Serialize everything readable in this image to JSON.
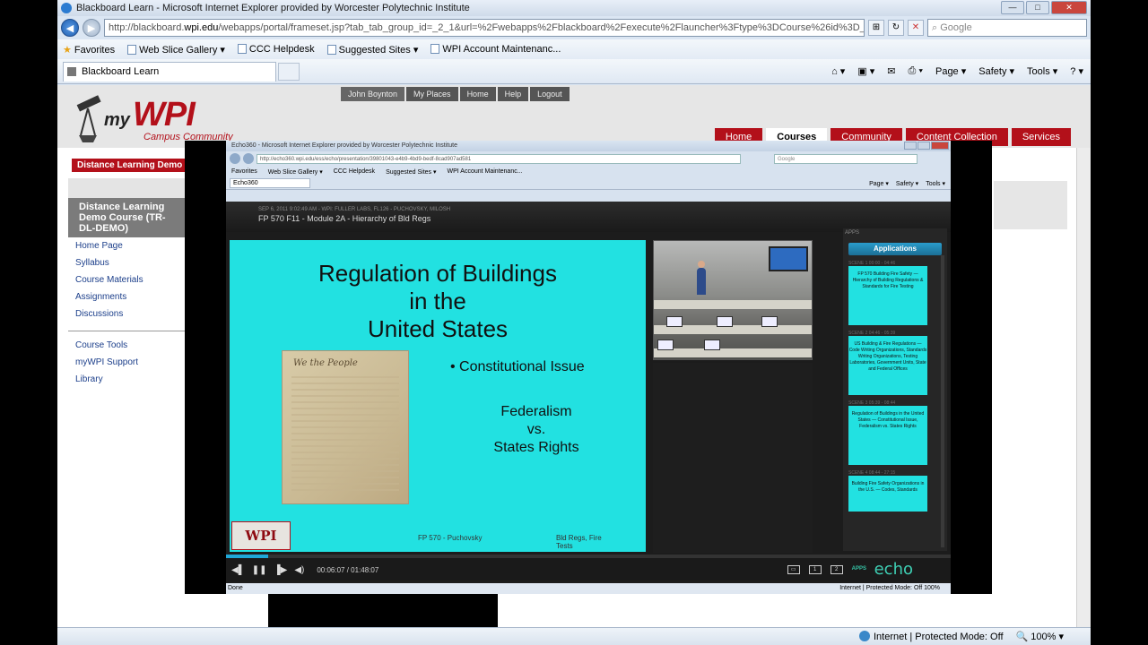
{
  "ie": {
    "title": "Blackboard Learn - Microsoft Internet Explorer provided by Worcester Polytechnic Institute",
    "url_prefix": "http://blackboard.",
    "url_domain": "wpi.edu",
    "url_rest": "/webapps/portal/frameset.jsp?tab_tab_group_id=_2_1&url=%2Fwebapps%2Fblackboard%2Fexecute%2Flauncher%3Ftype%3DCourse%26id%3D_925_1",
    "search_placeholder": "Google",
    "favorites": [
      "Favorites",
      "Web Slice Gallery ▾",
      "CCC Helpdesk",
      "Suggested Sites ▾",
      "WPI Account Maintenanc..."
    ],
    "tab_label": "Blackboard Learn",
    "commands": [
      "Page ▾",
      "Safety ▾",
      "Tools ▾"
    ],
    "status_zone": "Internet | Protected Mode: Off",
    "zoom": "100%"
  },
  "bb": {
    "logo_my": "my",
    "logo_wpi": "WPI",
    "logo_sub": "Campus Community",
    "toplinks": [
      "John Boynton",
      "My Places",
      "Home",
      "Help",
      "Logout"
    ],
    "tabs": [
      "Home",
      "Courses",
      "Community",
      "Content Collection",
      "Services"
    ],
    "crumb": "Distance Learning Demo Co",
    "course_title": "Distance Learning Demo Course (TR-DL-DEMO)",
    "menu1": [
      "Home Page",
      "Syllabus",
      "Course Materials",
      "Assignments",
      "Discussions"
    ],
    "menu2": [
      "Course Tools",
      "myWPI Support",
      "Library"
    ]
  },
  "echo": {
    "title": "Echo360 - Microsoft Internet Explorer provided by Worcester Polytechnic Institute",
    "url": "http://echo360.wpi.edu/ess/echo/presentation/39801043-e4b9-4bd9-bedf-8cad907ad581",
    "search": "Google",
    "favorites": [
      "Favorites",
      "Web Slice Gallery ▾",
      "CCC Helpdesk",
      "Suggested Sites ▾",
      "WPI Account Maintenanc..."
    ],
    "tab_label": "Echo360",
    "commands": [
      "Page ▾",
      "Safety ▾",
      "Tools ▾"
    ],
    "date_line": "SEP 6, 2011 9:02:49 AM - WPI: FULLER LABS, FL126 - PUCHOVSKY, MILOSH",
    "course_line": "FP 570 F11 - Module 2A - Hierarchy of Bld Regs",
    "apps_header": "APPS",
    "applications_label": "Applications",
    "time": "00:06:07 / 01:48:07",
    "progress": 0.058,
    "apps_btn": "APPS",
    "logo": "echo",
    "status_left": "Done",
    "status_right": "Internet | Protected Mode: Off   100%"
  },
  "slide": {
    "title_l1": "Regulation of Buildings",
    "title_l2": "in the",
    "title_l3": "United States",
    "doc_caption": "We the People",
    "bullet": "• Constitutional Issue",
    "fed_l1": "Federalism",
    "fed_l2": "vs.",
    "fed_l3": "States Rights",
    "logo": "WPI",
    "footer_course": "FP 570 - Puchovsky",
    "footer_topic_l1": "Bld Regs, Fire",
    "footer_topic_l2": "Tests"
  },
  "thumbs": [
    {
      "meta": "SCENE 1   00:00 - 04:46",
      "text": "FP 570 Building Fire Safety — Hierarchy of Building Regulations & Standards for Fire Testing"
    },
    {
      "meta": "SCENE 2   04:46 - 05:39",
      "text": "US Building & Fire Regulations — Code Writing Organizations, Standards Writing Organizations, Testing Laboratories, Government Units, State and Federal Offices"
    },
    {
      "meta": "SCENE 3   05:39 - 08:44",
      "text": "Regulation of Buildings in the United States — Constitutional Issue, Federalism vs. States Rights"
    },
    {
      "meta": "SCENE 4   08:44 - 27:15",
      "text": "Building Fire Safety Organizations in the U.S. — Codes, Standards"
    }
  ]
}
